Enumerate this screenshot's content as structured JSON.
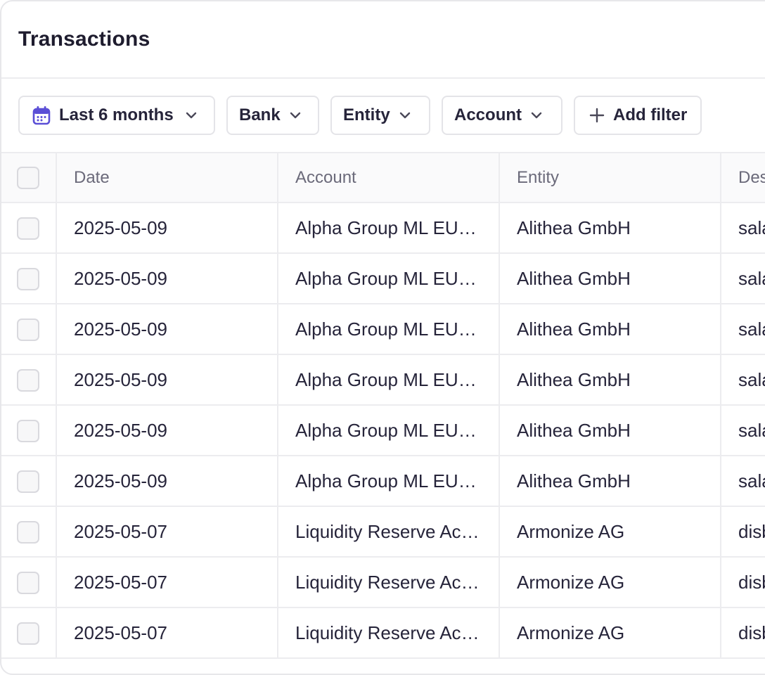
{
  "page": {
    "title": "Transactions"
  },
  "filters": {
    "date_range": "Last 6 months",
    "bank": "Bank",
    "entity": "Entity",
    "account": "Account",
    "add_filter": "Add filter"
  },
  "table": {
    "columns": [
      "Date",
      "Account",
      "Entity",
      "Description"
    ],
    "rows": [
      {
        "date": "2025-05-09",
        "account": "Alpha Group ML EUR Account",
        "entity": "Alithea GmbH",
        "description": "salary"
      },
      {
        "date": "2025-05-09",
        "account": "Alpha Group ML EUR Account",
        "entity": "Alithea GmbH",
        "description": "salary"
      },
      {
        "date": "2025-05-09",
        "account": "Alpha Group ML EUR Account",
        "entity": "Alithea GmbH",
        "description": "salary"
      },
      {
        "date": "2025-05-09",
        "account": "Alpha Group ML EUR Account",
        "entity": "Alithea GmbH",
        "description": "salary"
      },
      {
        "date": "2025-05-09",
        "account": "Alpha Group ML EUR Account",
        "entity": "Alithea GmbH",
        "description": "salary"
      },
      {
        "date": "2025-05-09",
        "account": "Alpha Group ML EUR Account",
        "entity": "Alithea GmbH",
        "description": "salary"
      },
      {
        "date": "2025-05-07",
        "account": "Liquidity Reserve Account",
        "entity": "Armonize AG",
        "description": "disbursement"
      },
      {
        "date": "2025-05-07",
        "account": "Liquidity Reserve Account",
        "entity": "Armonize AG",
        "description": "disbursement"
      },
      {
        "date": "2025-05-07",
        "account": "Liquidity Reserve Account",
        "entity": "Armonize AG",
        "description": "disbursement"
      }
    ]
  },
  "colors": {
    "accent": "#5b4fd6",
    "border": "#ececef",
    "header_bg": "#fafafb"
  },
  "icons": {
    "date_chip": "calendar-icon",
    "dropdown": "chevron-down-icon",
    "add": "plus-icon"
  }
}
